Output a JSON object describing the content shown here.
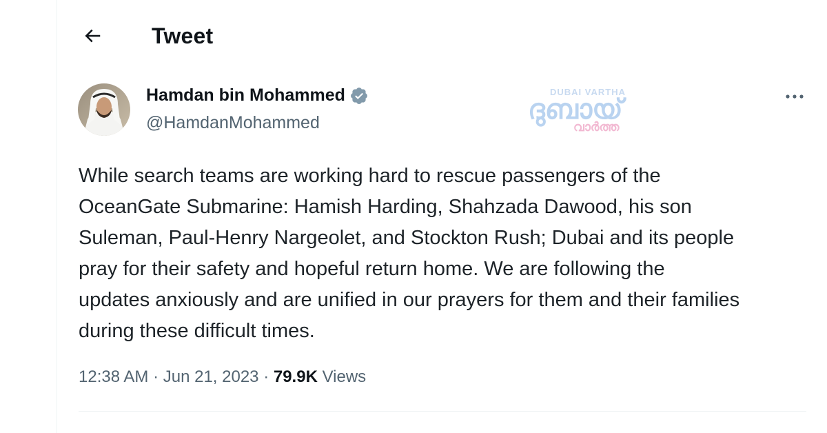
{
  "header": {
    "title": "Tweet",
    "back_icon": "arrow-left-icon"
  },
  "author": {
    "name": "Hamdan bin Mohammed",
    "handle": "@HamdanMohammed",
    "verified": true,
    "verified_color": "#829aab",
    "avatar_icon": "profile-photo"
  },
  "watermark": {
    "top_text": "DUBAI VARTHA",
    "main_text": "ദുബായ്",
    "sub_text": "വാർത്ത",
    "colors": {
      "main": "#b9d3f0",
      "sub": "#f2b9d2"
    }
  },
  "more_icon": "more-horizontal-icon",
  "tweet": {
    "text": "While search teams are working hard  to rescue passengers of the\nOceanGate Submarine: Hamish Harding, Shahzada Dawood, his son\nSuleman, Paul-Henry Nargeolet, and Stockton Rush; Dubai and its people\npray for their safety and hopeful return home. We are following the\nupdates anxiously and are unified in our prayers for them and their families\nduring these difficult times."
  },
  "meta": {
    "time": "12:38 AM",
    "separator": " · ",
    "date": "Jun 21, 2023",
    "views_count": "79.9K",
    "views_label": " Views"
  },
  "colors": {
    "text_primary": "#0f1419",
    "text_secondary": "#536471",
    "divider": "#eff3f4"
  }
}
